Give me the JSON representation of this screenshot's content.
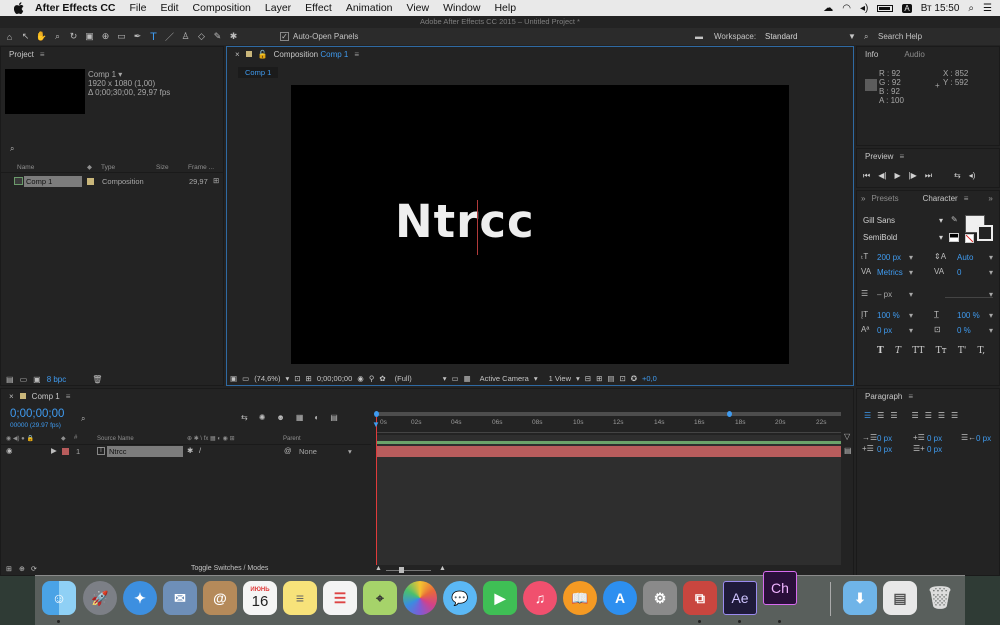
{
  "menubar": {
    "app_name": "After Effects CC",
    "items": [
      "File",
      "Edit",
      "Composition",
      "Layer",
      "Effect",
      "Animation",
      "View",
      "Window",
      "Help"
    ],
    "clock": "Вт 15:50",
    "input_lang": "A"
  },
  "window_title": "Adobe After Effects CC 2015 – Untitled Project *",
  "toolbar": {
    "auto_open_label": "Auto-Open Panels",
    "workspace_label": "Workspace:",
    "workspace_value": "Standard",
    "search_placeholder": "Search Help"
  },
  "project": {
    "tab": "Project",
    "comp_name": "Comp 1 ▾",
    "comp_res": "1920 x 1080 (1,00)",
    "comp_dur": "Δ 0;00;30;00, 29,97 fps",
    "search_placeholder": "",
    "cols": {
      "name": "Name",
      "type": "Type",
      "size": "Size",
      "frame": "Frame ..."
    },
    "items": [
      {
        "name": "Comp 1",
        "type": "Composition",
        "size": "",
        "frame": "29,97"
      }
    ],
    "bpc": "8 bpc"
  },
  "composition": {
    "tab_prefix": "Composition",
    "tab_name": "Comp 1",
    "subtab": "Comp 1",
    "canvas_text": "Ntrcc",
    "footer": {
      "zoom": "(74,6%)",
      "timecode": "0;00;00;00",
      "resolution": "(Full)",
      "camera": "Active Camera",
      "views": "1 View",
      "exposure": "+0,0"
    }
  },
  "info": {
    "tab_info": "Info",
    "tab_audio": "Audio",
    "r": "R : 92",
    "g": "G : 92",
    "b": "B : 92",
    "a": "A : 100",
    "x": "X : 852",
    "y": "Y : 592"
  },
  "preview": {
    "tab": "Preview"
  },
  "character": {
    "tab_presets": "Presets",
    "tab_character": "Character",
    "font": "Gill Sans",
    "style": "SemiBold",
    "size": "200 px",
    "leading": "Auto",
    "kerning": "Metrics",
    "tracking": "0",
    "stroke": "– px",
    "vscale": "100 %",
    "hscale": "100 %",
    "baseline": "0 px",
    "tsume": "0 %",
    "buttons": [
      "T",
      "T",
      "TT",
      "Tт",
      "T'",
      "T,"
    ]
  },
  "paragraph": {
    "tab": "Paragraph",
    "indent_left": "0 px",
    "indent_first": "0 px",
    "indent_right": "0 px",
    "space_before": "0 px",
    "space_after": "0 px"
  },
  "timeline": {
    "tab": "Comp 1",
    "timecode": "0;00;00;00",
    "frame_info": "00000 (29.97 fps)",
    "col_source": "Source Name",
    "col_parent": "Parent",
    "ruler": [
      "0s",
      "02s",
      "04s",
      "06s",
      "08s",
      "10s",
      "12s",
      "14s",
      "16s",
      "18s",
      "20s",
      "22s"
    ],
    "layer": {
      "index": "1",
      "name": "Ntrcc",
      "parent": "None"
    },
    "toggle_label": "Toggle Switches / Modes"
  },
  "dock": {
    "calendar_month": "ИЮНЬ",
    "calendar_day": "16",
    "ae_label": "Ae",
    "ch_label": "Ch"
  },
  "colors": {
    "accent": "#3f9bf0",
    "layer_bar": "#b85c5c",
    "playhead": "#e03b3b",
    "panel_bg": "#232323"
  }
}
